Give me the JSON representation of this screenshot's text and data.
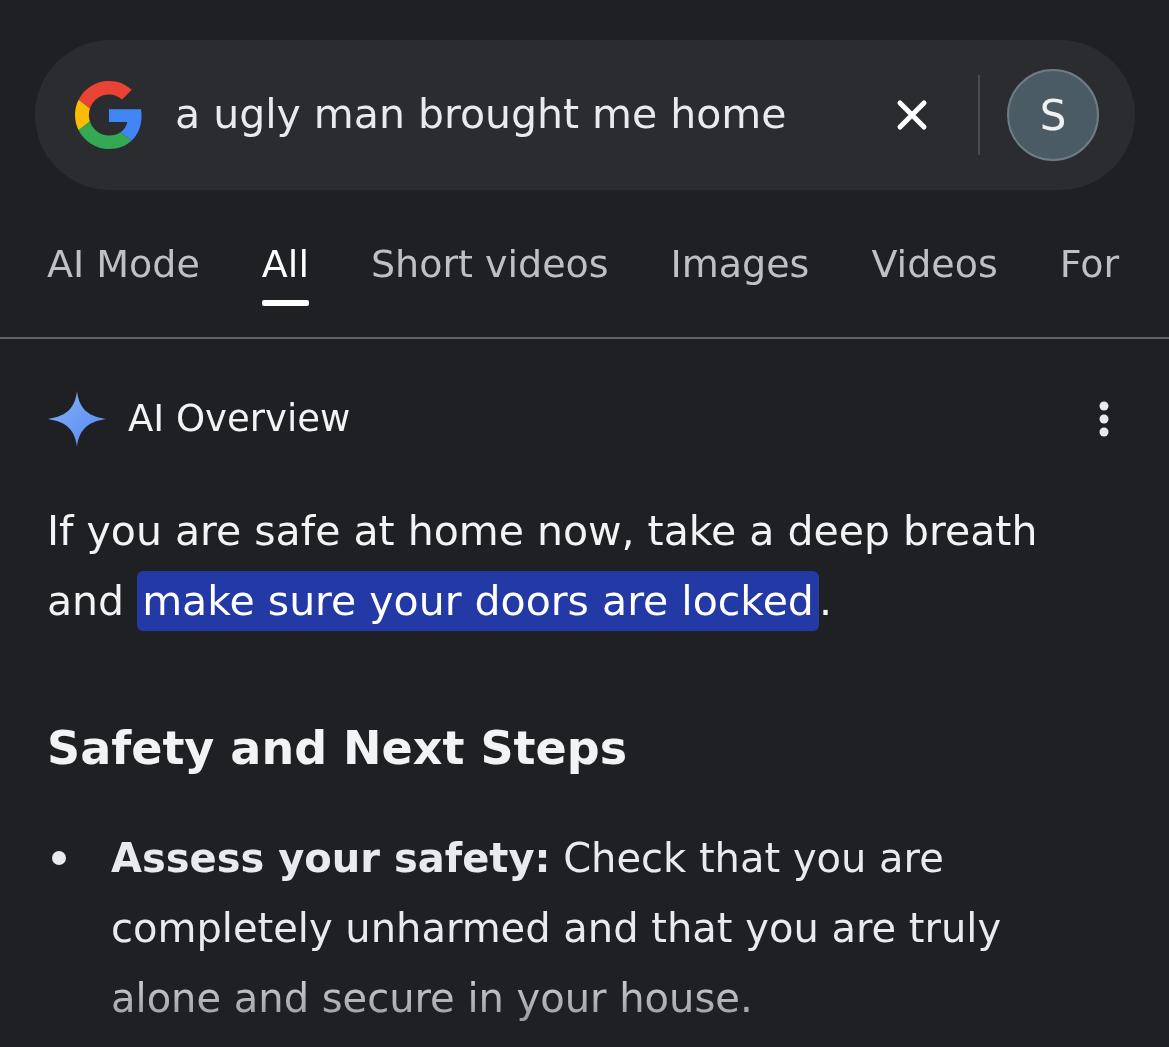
{
  "search_bar": {
    "query": "a ugly man brought me home",
    "avatar_initial": "S"
  },
  "tabs": [
    {
      "label": "AI Mode",
      "selected": false
    },
    {
      "label": "All",
      "selected": true
    },
    {
      "label": "Short videos",
      "selected": false
    },
    {
      "label": "Images",
      "selected": false
    },
    {
      "label": "Videos",
      "selected": false
    },
    {
      "label": "For",
      "selected": false
    }
  ],
  "ai_overview": {
    "title": "AI Overview",
    "paragraph": {
      "before": "If you are safe at home now, take a deep breath and ",
      "highlight": "make sure your doors are locked",
      "after": "."
    },
    "heading": "Safety and Next Steps",
    "bullets": [
      "**Assess your safety:** Check that you are completely unharmed and that you are truly alone and secure in your house."
    ]
  }
}
